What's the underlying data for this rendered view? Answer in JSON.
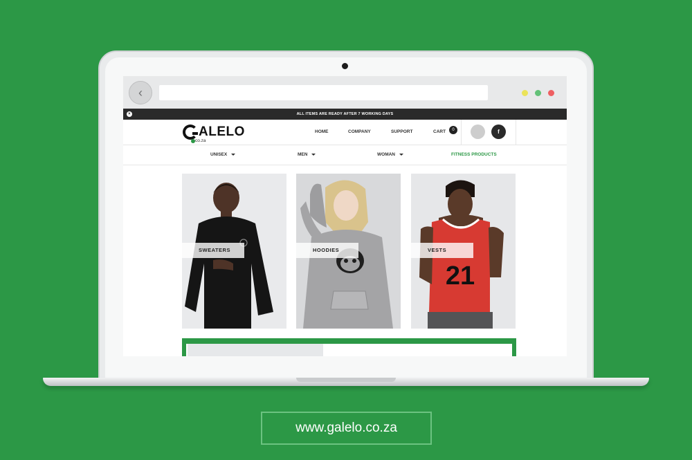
{
  "browser": {
    "back_icon": "chevron-left-icon",
    "url": ""
  },
  "site": {
    "announcement": "ALL ITEMS ARE READY AFTER 7 WORKING DAYS",
    "logo_text": "ALELO",
    "logo_sub": "co.za",
    "nav": {
      "home": "HOME",
      "company": "COMPANY",
      "support": "SUPPORT",
      "cart": "CART",
      "cart_count": "0"
    },
    "facebook_label": "f",
    "categories": {
      "unisex": "UNISEX",
      "men": "MEN",
      "woman": "WOMAN",
      "fitness": "FITNESS PRODUCTS"
    },
    "cards": {
      "sweaters": "SWEATERS",
      "hoodies": "HOODIES",
      "vests": "VESTS"
    },
    "vest_number": "21"
  },
  "footer_url": "www.galelo.co.za",
  "colors": {
    "background": "#2c9846",
    "accent": "#2c9846",
    "dark": "#2a2a2a"
  }
}
